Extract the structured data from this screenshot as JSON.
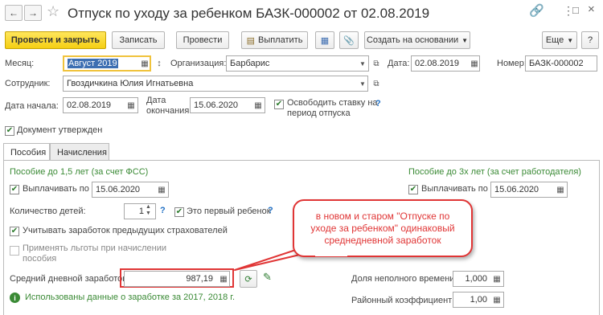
{
  "window": {
    "title": "Отпуск по уходу за ребенком БАЗК-000002 от 02.08.2019"
  },
  "toolbar": {
    "post_close": "Провести и закрыть",
    "save": "Записать",
    "post": "Провести",
    "pay": "Выплатить",
    "create_based": "Создать на основании",
    "more": "Еще",
    "help": "?"
  },
  "header": {
    "month_label": "Месяц:",
    "month_value": "Август 2019",
    "org_label": "Организация:",
    "org_value": "Барбарис",
    "date_label": "Дата:",
    "date_value": "02.08.2019",
    "number_label": "Номер:",
    "number_value": "БАЗК-000002",
    "employee_label": "Сотрудник:",
    "employee_value": "Гвоздичкина Юлия Игнатьевна",
    "start_label": "Дата начала:",
    "start_value": "02.08.2019",
    "end_label_1": "Дата",
    "end_label_2": "окончания:",
    "end_value": "15.06.2020",
    "release_label_1": "Освободить ставку на",
    "release_label_2": "период отпуска",
    "approved_label": "Документ утвержден"
  },
  "tabs": [
    "Пособия",
    "Начисления"
  ],
  "benefits": {
    "under15_title": "Пособие до 1,5 лет (за счет ФСС)",
    "under3_title": "Пособие до 3х лет (за счет работодателя)",
    "pay_until_label": "Выплачивать по",
    "pay_until_value": "15.06.2020",
    "pay_until3_label": "Выплачивать по",
    "pay_until3_value": "15.06.2020",
    "children_label": "Количество детей:",
    "children_value": "1",
    "first_child_label": "Это первый ребенок",
    "prev_insurers_label": "Учитывать заработок предыдущих страхователей",
    "apply_benefits_1": "Применять льготы при начислении",
    "apply_benefits_2": "пособия",
    "avg_earnings_label": "Средний дневной заработок:",
    "avg_earnings_value": "987,19",
    "used_data_text": "Использованы данные о заработке за  2017,  2018 г.",
    "part_time_label": "Доля неполного времени:",
    "part_time_value": "1,000",
    "district_label": "Районный коэффициент:",
    "district_value": "1,00"
  },
  "callout": {
    "text": "в новом и старом \"Отпуске по уходе за ребенком\" одинаковый среднедневной заработок"
  },
  "colors": {
    "accent_yellow": "#f5cf13",
    "green_text": "#3a8a35",
    "callout_red": "#e03535"
  }
}
